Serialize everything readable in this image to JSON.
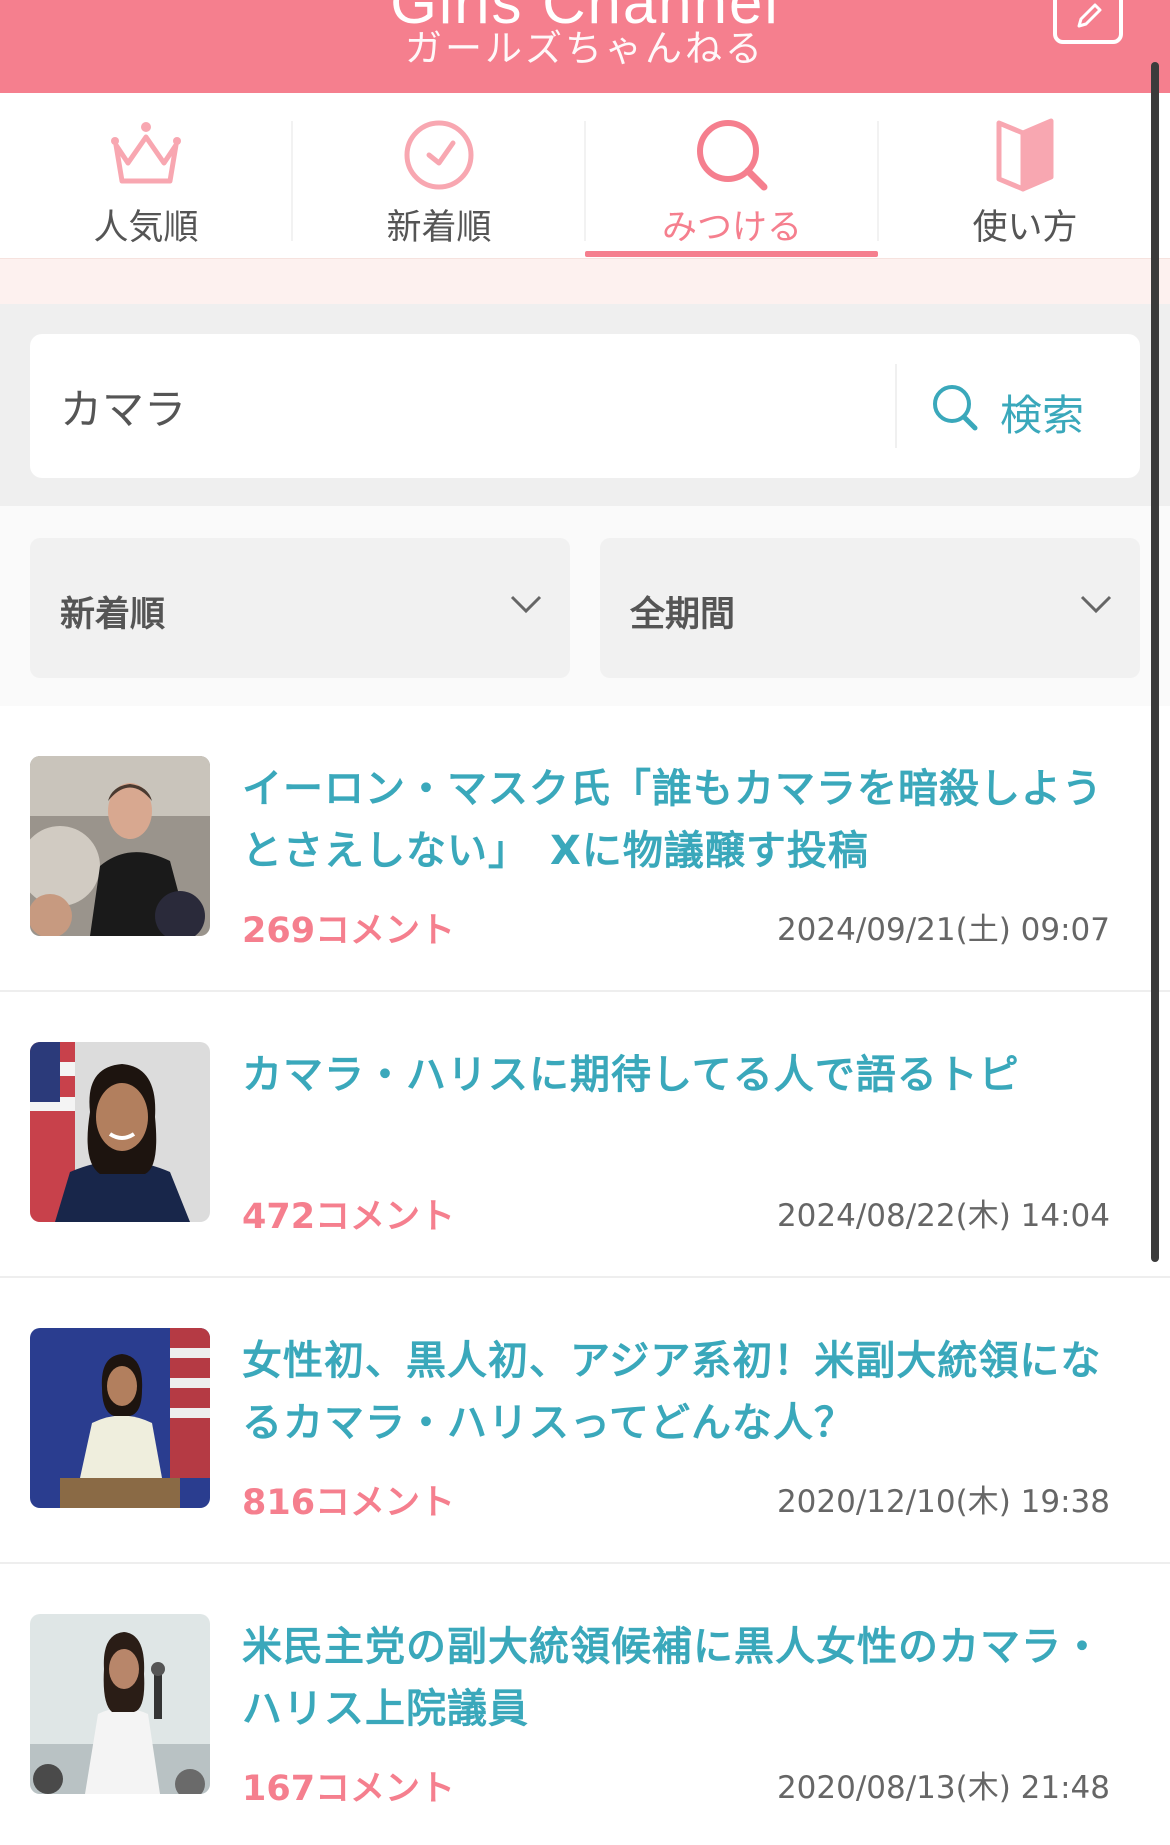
{
  "header": {
    "logo_en": "Girls Channel",
    "logo_ja": "ガールズちゃんねる",
    "bg_color": "#f57f8e"
  },
  "tabs": [
    {
      "label": "人気順",
      "icon": "crown-icon",
      "active": false
    },
    {
      "label": "新着順",
      "icon": "clock-icon",
      "active": false
    },
    {
      "label": "みつける",
      "icon": "search-icon",
      "active": true
    },
    {
      "label": "使い方",
      "icon": "book-icon",
      "active": false
    }
  ],
  "search": {
    "value": "カマラ",
    "button_label": "検索"
  },
  "filters": {
    "sort": "新着順",
    "period": "全期間"
  },
  "topics": [
    {
      "title": "イーロン・マスク氏「誰もカマラを暗殺しようとさえしない」　Xに物議醸す投稿",
      "comments": "269コメント",
      "date": "2024/09/21(土) 09:07",
      "thumb": "elon-musk-photo"
    },
    {
      "title": "カマラ・ハリスに期待してる人で語るトピ",
      "comments": "472コメント",
      "date": "2024/08/22(木) 14:04",
      "thumb": "kamala-harris-portrait"
    },
    {
      "title": "女性初、黒人初、アジア系初！米副大統領になるカマラ・ハリスってどんな人？",
      "comments": "816コメント",
      "date": "2020/12/10(木) 19:38",
      "thumb": "kamala-harris-podium"
    },
    {
      "title": "米民主党の副大統領候補に黒人女性のカマラ・ハリス上院議員",
      "comments": "167コメント",
      "date": "2020/08/13(木) 21:48",
      "thumb": "kamala-harris-microphone"
    }
  ],
  "colors": {
    "accent": "#f57f8e",
    "link": "#3aa8bb"
  }
}
